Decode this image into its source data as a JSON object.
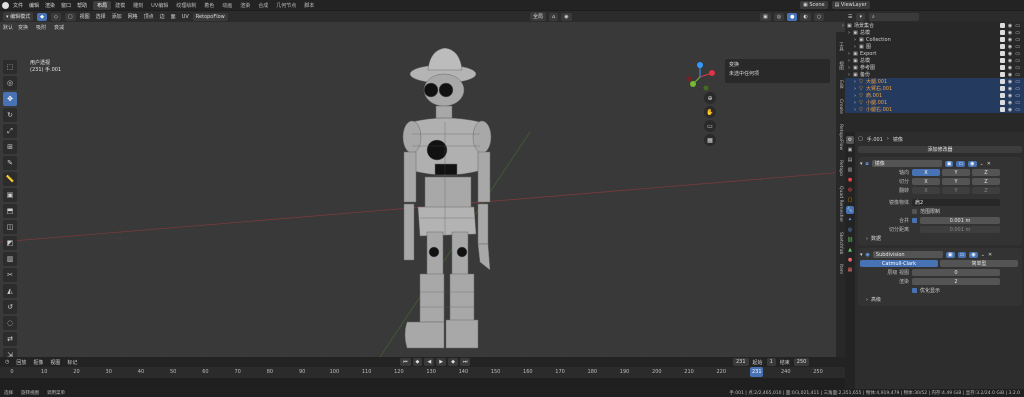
{
  "menu": [
    "文件",
    "编辑",
    "渲染",
    "窗口",
    "帮助"
  ],
  "workspaces": [
    "布局",
    "建模",
    "雕刻",
    "UV编辑",
    "纹理绘制",
    "着色",
    "动画",
    "渲染",
    "合成",
    "几何节点",
    "脚本"
  ],
  "scene_name": "Scene",
  "view_layer": "ViewLayer",
  "header": {
    "mode": "编辑模式",
    "menus": [
      "视图",
      "选择",
      "添加",
      "网格",
      "顶点",
      "边",
      "面",
      "UV"
    ],
    "retopo": "RetopoFlow",
    "transform": "全局",
    "snapping": "默认",
    "row2": [
      "变换",
      "吸附",
      "衰减"
    ]
  },
  "overlay_text": {
    "view": "用户透视",
    "object": "(231) 手.001"
  },
  "operator_panel": {
    "title": "变换",
    "subtitle": "未选中任何项"
  },
  "tool_icons": [
    "select-box-icon",
    "cursor-icon",
    "move-icon",
    "rotate-icon",
    "scale-icon",
    "transform-icon",
    "annotate-icon",
    "measure-icon",
    "add-cube-icon",
    "extrude-icon",
    "inset-icon",
    "bevel-icon",
    "loop-cut-icon",
    "knife-icon",
    "poly-build-icon",
    "spin-icon",
    "smooth-icon",
    "edge-slide-icon",
    "shrink-icon",
    "shear-icon",
    "rip-icon"
  ],
  "npanel_tabs": [
    "工具",
    "视图",
    "Edit",
    "Create",
    "RetopoFlow",
    "Retopo",
    "Quad Remesher",
    "Sketchfab",
    "Item"
  ],
  "timeline": {
    "menus": [
      "回放",
      "抠像",
      "视图",
      "标记"
    ],
    "current_frame": "231",
    "start_label": "起始",
    "start": "1",
    "end_label": "结束",
    "end": "250",
    "ruler_ticks": [
      "0",
      "10",
      "20",
      "30",
      "40",
      "50",
      "60",
      "70",
      "80",
      "90",
      "100",
      "110",
      "120",
      "130",
      "140",
      "150",
      "160",
      "170",
      "180",
      "190",
      "200",
      "210",
      "220",
      "231",
      "240",
      "250"
    ]
  },
  "statusbar": {
    "left": [
      "选择",
      "旋转视图",
      "调用菜单"
    ],
    "right": "手.001 | 点:2/2,465,010 | 面:0/3,021,411 | 三角面:2,351,655 | 物体:4,919,479 | 物体:30/52 | 内存:4.49 GiB | 显存:3.2/24.0 GiB | 3.2.0"
  },
  "outliner": {
    "rows": [
      {
        "name": "场景集合",
        "indent": 2,
        "sel": false
      },
      {
        "name": "总模",
        "indent": 8,
        "sel": false
      },
      {
        "name": "Collection",
        "indent": 14,
        "sel": false
      },
      {
        "name": "图",
        "indent": 14,
        "sel": false
      },
      {
        "name": "Export",
        "indent": 8,
        "sel": false
      },
      {
        "name": "总模",
        "indent": 8,
        "sel": false
      },
      {
        "name": "参考图",
        "indent": 8,
        "sel": false
      },
      {
        "name": "备份",
        "indent": 8,
        "sel": false
      },
      {
        "name": "大腿.001",
        "indent": 14,
        "sel": true
      },
      {
        "name": "大臂右.001",
        "indent": 14,
        "sel": true
      },
      {
        "name": "肩.001",
        "indent": 14,
        "sel": true
      },
      {
        "name": "小腿.001",
        "indent": 14,
        "sel": true
      },
      {
        "name": "小腿右.001",
        "indent": 14,
        "sel": true
      }
    ]
  },
  "properties": {
    "object_name": "手.001",
    "modifier_label": "镜像",
    "add_modifier": "添加修改器",
    "mirror": {
      "name": "镜像",
      "axis_label": "轴向",
      "bisect_label": "切分",
      "flip_label": "翻转",
      "x": "X",
      "y": "Y",
      "z": "Z",
      "mirror_object_label": "镜像物体",
      "mirror_object": "肩2",
      "clipping": "范围限制",
      "merge_label": "合并",
      "merge_value": "0.001 m",
      "bisect_distance_label": "切分距离",
      "bisect_distance": "0.001 m",
      "data": "数据"
    },
    "subsurf": {
      "name": "Subdivision",
      "catmull": "Catmull-Clark",
      "simple": "简单型",
      "levels_label": "层级 视图",
      "levels": "0",
      "render_label": "渲染",
      "render": "2",
      "optimal": "优化显示",
      "advanced": "高级"
    }
  }
}
